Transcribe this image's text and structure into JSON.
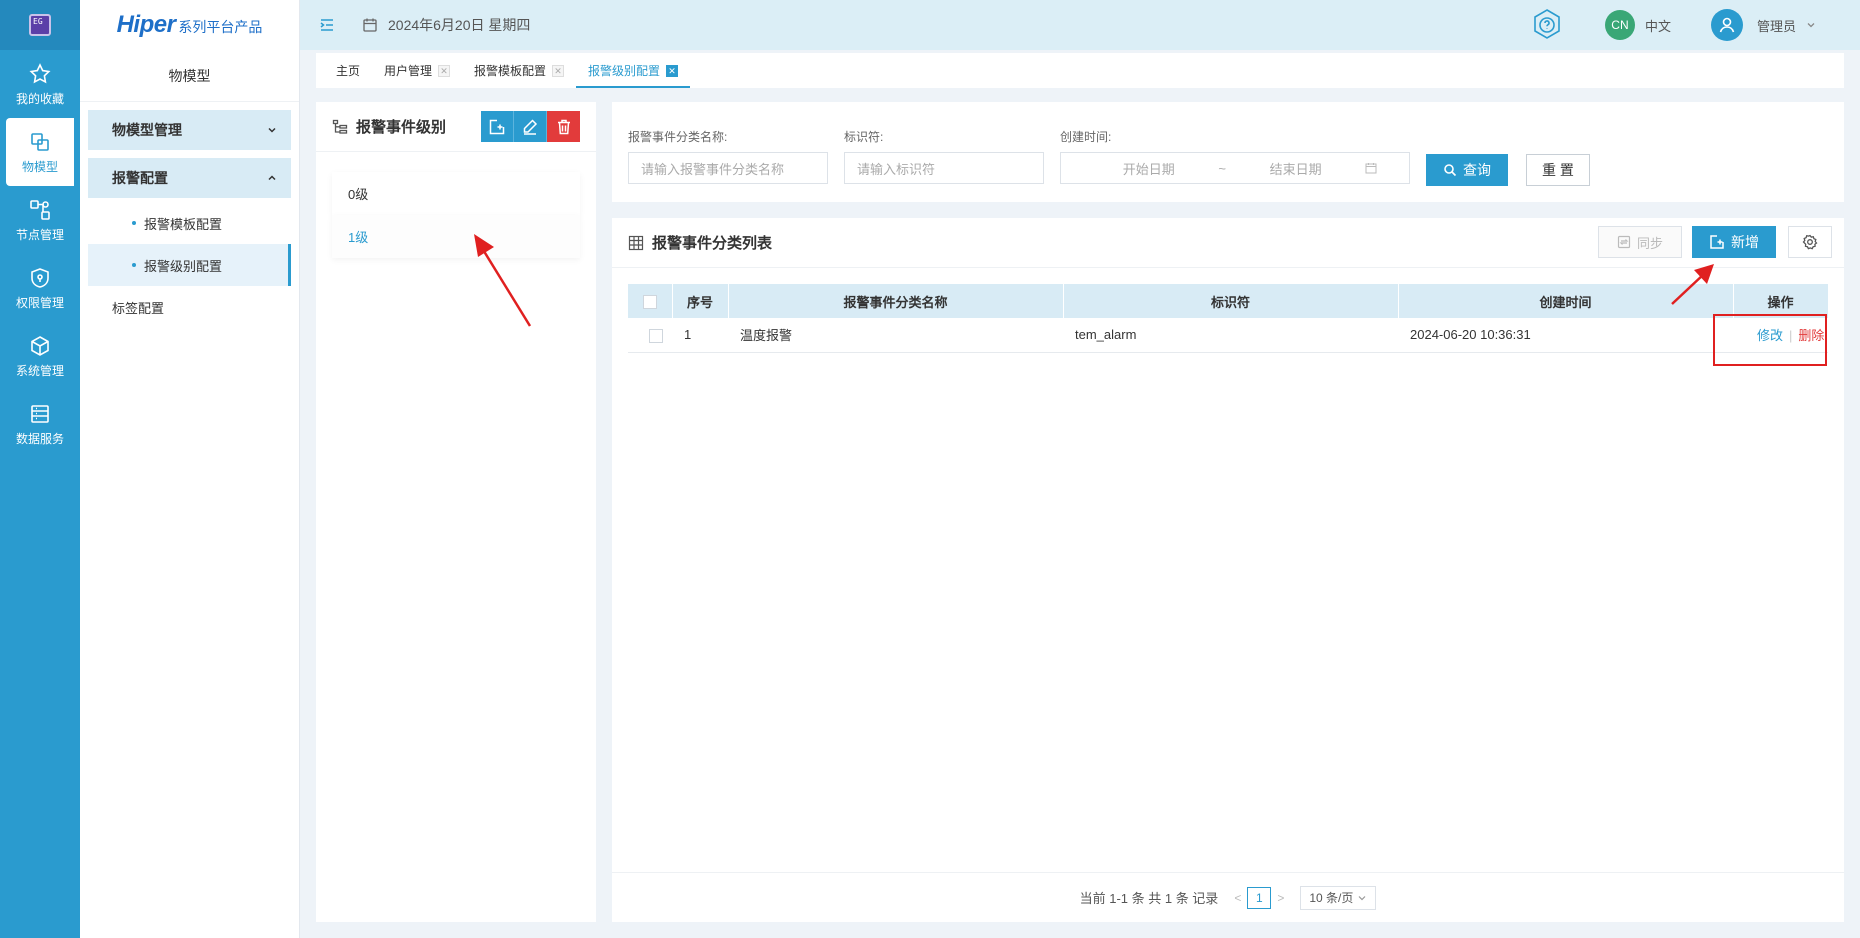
{
  "rail": {
    "logo_text": "EG",
    "items": [
      {
        "label": "我的收藏"
      },
      {
        "label": "物模型"
      },
      {
        "label": "节点管理"
      },
      {
        "label": "权限管理"
      },
      {
        "label": "系统管理"
      },
      {
        "label": "数据服务"
      }
    ]
  },
  "brand": {
    "name": "Hiper",
    "suffix": "系列平台产品"
  },
  "submenu": {
    "title": "物模型",
    "group1": "物模型管理",
    "group2": "报警配置",
    "sub1": "报警模板配置",
    "sub2": "报警级别配置",
    "plain": "标签配置"
  },
  "header": {
    "date": "2024年6月20日 星期四",
    "lang_badge": "CN",
    "lang": "中文",
    "user": "管理员"
  },
  "tabs": [
    {
      "label": "主页"
    },
    {
      "label": "用户管理"
    },
    {
      "label": "报警模板配置"
    },
    {
      "label": "报警级别配置"
    }
  ],
  "level_panel": {
    "title": "报警事件级别",
    "items": [
      {
        "label": "0级"
      },
      {
        "label": "1级"
      }
    ]
  },
  "search": {
    "name_label": "报警事件分类名称:",
    "name_placeholder": "请输入报警事件分类名称",
    "code_label": "标识符:",
    "code_placeholder": "请输入标识符",
    "time_label": "创建时间:",
    "start_placeholder": "开始日期",
    "range_sep": "~",
    "end_placeholder": "结束日期",
    "query": "查询",
    "reset": "重 置"
  },
  "table": {
    "title": "报警事件分类列表",
    "sync": "同步",
    "add": "新增",
    "columns": [
      "序号",
      "报警事件分类名称",
      "标识符",
      "创建时间",
      "操作"
    ],
    "rows": [
      {
        "index": "1",
        "name": "温度报警",
        "code": "tem_alarm",
        "created": "2024-06-20 10:36:31",
        "edit": "修改",
        "delete": "删除"
      }
    ]
  },
  "pager": {
    "summary": "当前 1-1 条 共 1 条 记录",
    "prev": "<",
    "page": "1",
    "next": ">",
    "size": "10 条/页"
  },
  "colors": {
    "accent": "#2a9bcf",
    "danger": "#e23b3b",
    "annotation": "#e02020"
  }
}
